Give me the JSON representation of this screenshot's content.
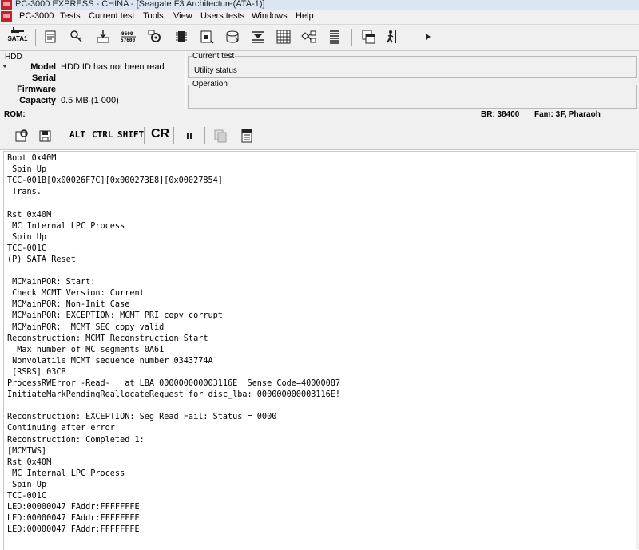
{
  "window": {
    "title": "PC-3000 EXPRESS - CHINA - [Seagate F3 Architecture(ATA-1)]"
  },
  "menu": {
    "items": [
      "PC-3000",
      "Tests",
      "Current test",
      "Tools",
      "View",
      "Users tests",
      "Windows",
      "Help"
    ]
  },
  "toolbar": {
    "sata_label": "SATA1"
  },
  "hdd": {
    "group_title": "HDD",
    "model_label": "Model",
    "model_value": "HDD ID has not been read",
    "serial_label": "Serial",
    "serial_value": "",
    "firmware_label": "Firmware",
    "firmware_value": "",
    "capacity_label": "Capacity",
    "capacity_value": "0.5 MB (1 000)"
  },
  "current_test": {
    "group_title": "Current test",
    "status": "Utility status",
    "operation_title": "Operation"
  },
  "rom": {
    "label": "ROM:",
    "br": "BR: 38400",
    "fam": "Fam: 3F, Pharaoh"
  },
  "toolbar2": {
    "alt": "ALT",
    "ctrl": "CTRL",
    "shift": "SHIFT",
    "cr": "CR"
  },
  "log": {
    "lines": [
      "Boot 0x40M",
      " Spin Up",
      "TCC-001B[0x00026F7C][0x000273E8][0x00027854]",
      " Trans.",
      "",
      "Rst 0x40M",
      " MC Internal LPC Process",
      " Spin Up",
      "TCC-001C",
      "(P) SATA Reset",
      "",
      " MCMainPOR: Start:",
      " Check MCMT Version: Current",
      " MCMainPOR: Non-Init Case",
      " MCMainPOR: EXCEPTION: MCMT PRI copy corrupt",
      " MCMainPOR:  MCMT SEC copy valid",
      "Reconstruction: MCMT Reconstruction Start",
      "  Max number of MC segments 0A61",
      " Nonvolatile MCMT sequence number 0343774A",
      " [RSRS] 03CB",
      "ProcessRWError -Read-   at LBA 000000000003116E  Sense Code=40000087",
      "InitiateMarkPendingReallocateRequest for disc_lba: 000000000003116E!",
      "",
      "Reconstruction: EXCEPTION: Seg Read Fail: Status = 0000",
      "Continuing after error",
      "Reconstruction: Completed 1:",
      "[MCMTWS]",
      "Rst 0x40M",
      " MC Internal LPC Process",
      " Spin Up",
      "TCC-001C",
      "LED:00000047 FAddr:FFFFFFFE",
      "LED:00000047 FAddr:FFFFFFFE",
      "LED:00000047 FAddr:FFFFFFFE"
    ]
  }
}
